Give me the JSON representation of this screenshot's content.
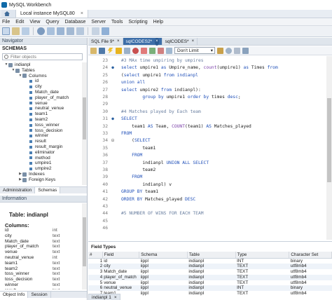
{
  "window": {
    "title": "MySQL Workbench"
  },
  "instance_tab": {
    "label": "Local instance MySQL80",
    "close": "×"
  },
  "menu": [
    "File",
    "Edit",
    "View",
    "Query",
    "Database",
    "Server",
    "Tools",
    "Scripting",
    "Help"
  ],
  "navigator": {
    "header": "Navigator",
    "schemas_label": "SCHEMAS",
    "filter_placeholder": "Filter objects",
    "tree": [
      {
        "label": "indianpl",
        "level": 0,
        "kind": "db",
        "arrow": "▼"
      },
      {
        "label": "Tables",
        "level": 1,
        "kind": "folder",
        "arrow": "▼"
      },
      {
        "label": "Columns",
        "level": 2,
        "kind": "folder",
        "arrow": "▼"
      },
      {
        "label": "id",
        "level": 3,
        "kind": "col"
      },
      {
        "label": "city",
        "level": 3,
        "kind": "col"
      },
      {
        "label": "Match_date",
        "level": 3,
        "kind": "col"
      },
      {
        "label": "player_of_match",
        "level": 3,
        "kind": "col"
      },
      {
        "label": "venue",
        "level": 3,
        "kind": "col"
      },
      {
        "label": "neutral_venue",
        "level": 3,
        "kind": "col"
      },
      {
        "label": "team1",
        "level": 3,
        "kind": "col"
      },
      {
        "label": "team2",
        "level": 3,
        "kind": "col"
      },
      {
        "label": "toss_winner",
        "level": 3,
        "kind": "col"
      },
      {
        "label": "toss_decision",
        "level": 3,
        "kind": "col"
      },
      {
        "label": "winner",
        "level": 3,
        "kind": "col"
      },
      {
        "label": "result",
        "level": 3,
        "kind": "col"
      },
      {
        "label": "result_margin",
        "level": 3,
        "kind": "col"
      },
      {
        "label": "eliminator",
        "level": 3,
        "kind": "col"
      },
      {
        "label": "method",
        "level": 3,
        "kind": "col"
      },
      {
        "label": "umpire1",
        "level": 3,
        "kind": "col"
      },
      {
        "label": "umpire2",
        "level": 3,
        "kind": "col"
      },
      {
        "label": "Indexes",
        "level": 2,
        "kind": "folder",
        "arrow": "▶"
      },
      {
        "label": "Foreign Keys",
        "level": 2,
        "kind": "folder",
        "arrow": "▶"
      }
    ],
    "bottom_tabs": [
      "Administration",
      "Schemas"
    ]
  },
  "information": {
    "header": "Information",
    "table_title": "Table: indianpl",
    "columns_title": "Columns:",
    "columns": [
      {
        "name": "id",
        "type": "int"
      },
      {
        "name": "city",
        "type": "text"
      },
      {
        "name": "Match_date",
        "type": "text"
      },
      {
        "name": "player_of_match",
        "type": "text"
      },
      {
        "name": "venue",
        "type": "text"
      },
      {
        "name": "neutral_venue",
        "type": "int"
      },
      {
        "name": "team1",
        "type": "text"
      },
      {
        "name": "team2",
        "type": "text"
      },
      {
        "name": "toss_winner",
        "type": "text"
      },
      {
        "name": "toss_decision",
        "type": "text"
      },
      {
        "name": "winner",
        "type": "text"
      },
      {
        "name": "result",
        "type": "text"
      },
      {
        "name": "result_margin",
        "type": "int"
      }
    ],
    "bottom_tabs": [
      "Object Info",
      "Session"
    ]
  },
  "editor_tabs": [
    {
      "label": "SQL File 9*",
      "active": false
    },
    {
      "label": "sqlCODES2*",
      "active": true
    },
    {
      "label": "sqlCODES*",
      "active": false
    }
  ],
  "limit_select": {
    "value": "Don't Limit"
  },
  "code_lines": [
    {
      "ln": "23",
      "mark": "",
      "html": "<span class='cm'>#3 MAx time umpiring by umpires</span>"
    },
    {
      "ln": "24",
      "mark": "dot",
      "html": "<span class='kw'>select</span> umpire1 <span class='kw'>as</span> Umpire_name, <span class='fn'>count</span>(umpire1) <span class='kw'>as</span> Times <span class='kw'>from</span>"
    },
    {
      "ln": "25",
      "mark": "",
      "html": "(<span class='kw'>select</span> umpire1 <span class='kw'>from</span> <span class='tb'>indianpl</span>"
    },
    {
      "ln": "26",
      "mark": "",
      "html": "<span class='kw'>union all</span>"
    },
    {
      "ln": "27",
      "mark": "",
      "html": "<span class='kw'>select</span> umpire2 <span class='kw'>from</span> indianpl):"
    },
    {
      "ln": "28",
      "mark": "",
      "html": "        <span class='kw'>group by</span> umpire1 <span class='kw'>order by</span> times <span class='kw'>desc</span>;"
    },
    {
      "ln": "29",
      "mark": "",
      "html": ""
    },
    {
      "ln": "30",
      "mark": "",
      "html": "<span class='cm'>#4 Matches played by Each team</span>"
    },
    {
      "ln": "31",
      "mark": "dot",
      "html": "<span class='kw'>SELECT</span>"
    },
    {
      "ln": "32",
      "mark": "",
      "html": "    team1 <span class='kw'>AS</span> Team, <span class='fn'>COUNT</span>(team1) <span class='kw'>AS</span> Matches_played"
    },
    {
      "ln": "33",
      "mark": "",
      "html": "<span class='kw'>FROM</span>"
    },
    {
      "ln": "34",
      "mark": "minus",
      "html": "    (<span class='kw'>SELECT</span>"
    },
    {
      "ln": "35",
      "mark": "",
      "html": "        team1"
    },
    {
      "ln": "36",
      "mark": "",
      "html": "    <span class='kw'>FROM</span>"
    },
    {
      "ln": "37",
      "mark": "",
      "html": "        indianpl <span class='kw'>UNION ALL SELECT</span>"
    },
    {
      "ln": "38",
      "mark": "",
      "html": "        team2"
    },
    {
      "ln": "39",
      "mark": "",
      "html": "    <span class='kw'>FROM</span>"
    },
    {
      "ln": "40",
      "mark": "",
      "html": "        indianpl) v"
    },
    {
      "ln": "41",
      "mark": "",
      "html": "<span class='kw'>GROUP BY</span> team1"
    },
    {
      "ln": "42",
      "mark": "",
      "html": "<span class='kw'>ORDER BY</span> Matches_played <span class='kw'>DESC</span>"
    },
    {
      "ln": "43",
      "mark": "",
      "html": ""
    },
    {
      "ln": "44",
      "mark": "",
      "html": "<span class='cm'>#5 NUMBER OF WINS FOR EACH TEAM</span>"
    },
    {
      "ln": "45",
      "mark": "",
      "html": ""
    },
    {
      "ln": "46",
      "mark": "",
      "html": ""
    }
  ],
  "field_types": {
    "title": "Field Types",
    "headers": [
      "#",
      "Field",
      "Schema",
      "Table",
      "Type",
      "Character Set"
    ],
    "rows": [
      [
        "1",
        "id",
        "iippl",
        "indianpl",
        "INT",
        "binary"
      ],
      [
        "2",
        "city",
        "iippl",
        "indianpl",
        "TEXT",
        "utf8mb4"
      ],
      [
        "3",
        "Match_date",
        "iippl",
        "indianpl",
        "TEXT",
        "utf8mb4"
      ],
      [
        "4",
        "player_of_match",
        "iippl",
        "indianpl",
        "TEXT",
        "utf8mb4"
      ],
      [
        "5",
        "venue",
        "iippl",
        "indianpl",
        "TEXT",
        "utf8mb4"
      ],
      [
        "6",
        "neutral_venue",
        "iippl",
        "indianpl",
        "INT",
        "binary"
      ],
      [
        "7",
        "team1",
        "iippl",
        "indianpl",
        "TEXT",
        "utf8mb4"
      ]
    ]
  },
  "result_tab": {
    "label": "indianpl 1",
    "close": "×"
  }
}
